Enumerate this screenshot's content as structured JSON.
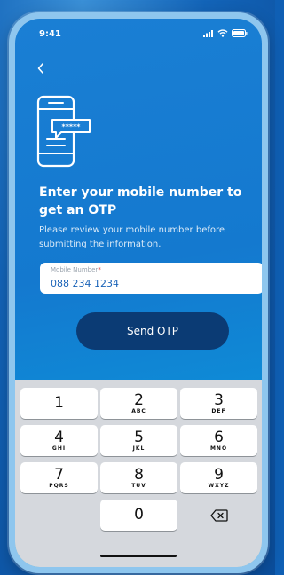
{
  "status_bar": {
    "time": "9:41",
    "icons": [
      "signal-icon",
      "wifi-icon",
      "battery-icon"
    ]
  },
  "nav": {
    "back_icon": "chevron-left-icon"
  },
  "illustration": "phone-otp-icon",
  "otp_mask": "*****",
  "heading": "Enter your mobile number to get an OTP",
  "subtext": "Please review your mobile number before submitting the information.",
  "mobile_field": {
    "label": "Mobile Number",
    "required_marker": "*",
    "value": "088 234 1234"
  },
  "send_button": {
    "label": "Send OTP"
  },
  "keypad": {
    "keys": [
      {
        "num": "1",
        "letters": ""
      },
      {
        "num": "2",
        "letters": "ABC"
      },
      {
        "num": "3",
        "letters": "DEF"
      },
      {
        "num": "4",
        "letters": "GHI"
      },
      {
        "num": "5",
        "letters": "JKL"
      },
      {
        "num": "6",
        "letters": "MNO"
      },
      {
        "num": "7",
        "letters": "PQRS"
      },
      {
        "num": "8",
        "letters": "TUV"
      },
      {
        "num": "9",
        "letters": "WXYZ"
      },
      {
        "num": "0",
        "letters": ""
      }
    ],
    "delete_icon": "backspace-icon"
  },
  "colors": {
    "accent": "#1479cf",
    "button": "#0b3b74",
    "value_text": "#1a63b8",
    "required": "#e03a3a"
  }
}
